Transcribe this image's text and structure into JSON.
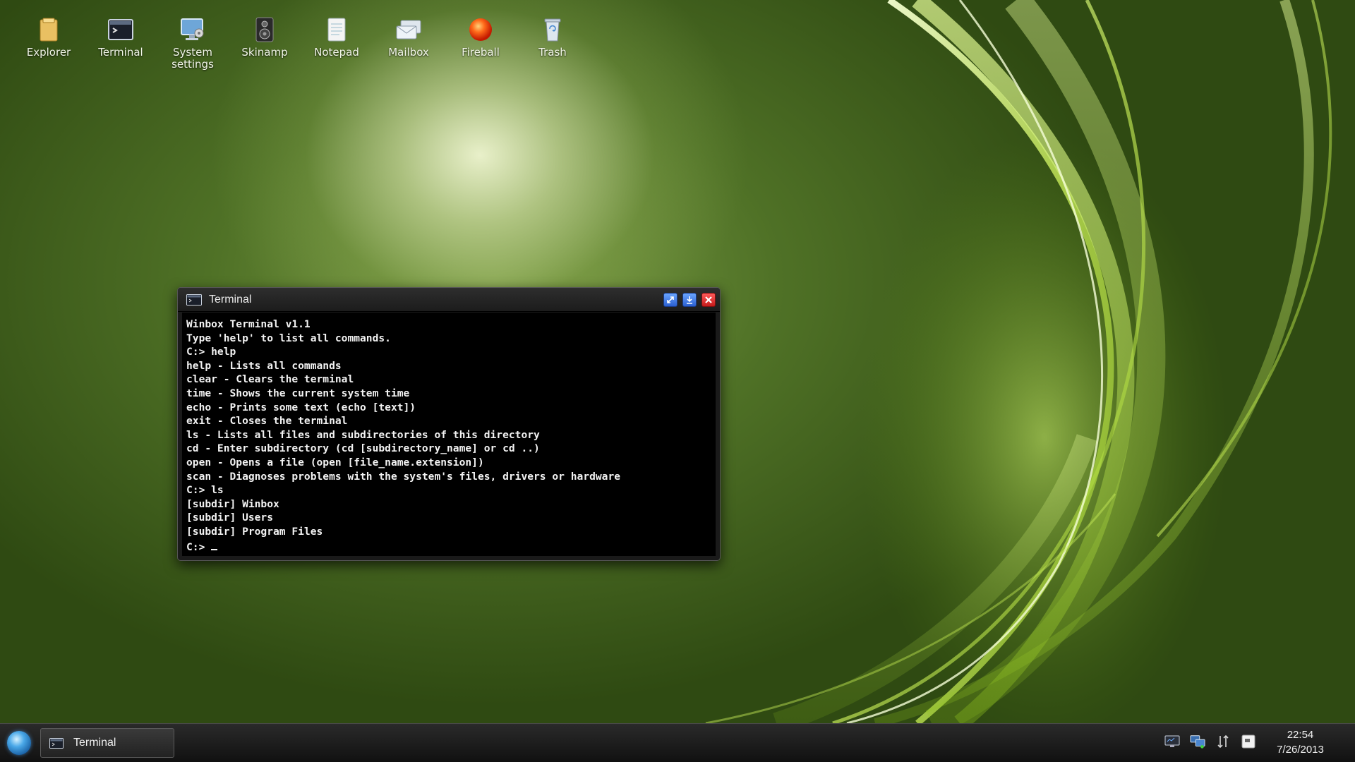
{
  "desktop": {
    "icons": [
      {
        "label": "Explorer",
        "icon": "folder-icon"
      },
      {
        "label": "Terminal",
        "icon": "terminal-icon"
      },
      {
        "label": "System\nsettings",
        "icon": "settings-icon"
      },
      {
        "label": "Skinamp",
        "icon": "speaker-icon"
      },
      {
        "label": "Notepad",
        "icon": "notepad-icon"
      },
      {
        "label": "Mailbox",
        "icon": "mail-icon"
      },
      {
        "label": "Fireball",
        "icon": "fireball-icon"
      },
      {
        "label": "Trash",
        "icon": "trash-icon"
      }
    ]
  },
  "terminal_window": {
    "title": "Terminal",
    "lines": [
      "Winbox Terminal v1.1",
      "Type 'help' to list all commands.",
      "C:> help",
      "help - Lists all commands",
      "clear - Clears the terminal",
      "time - Shows the current system time",
      "echo - Prints some text (echo [text])",
      "exit - Closes the terminal",
      "ls - Lists all files and subdirectories of this directory",
      "cd - Enter subdirectory (cd [subdirectory_name] or cd ..)",
      "open - Opens a file (open [file_name.extension])",
      "scan - Diagnoses problems with the system's files, drivers or hardware",
      "C:> ls",
      "[subdir] Winbox",
      "[subdir] Users",
      "[subdir] Program Files"
    ],
    "prompt": "C:> "
  },
  "taskbar": {
    "task_label": "Terminal",
    "tray_icons": [
      "monitor-icon",
      "network-icon",
      "transfer-icon",
      "notification-icon"
    ],
    "time": "22:54",
    "date": "7/26/2013"
  },
  "colors": {
    "accent_blue": "#2a5fd0",
    "close_red": "#c41a1a",
    "terminal_bg": "#000000"
  }
}
